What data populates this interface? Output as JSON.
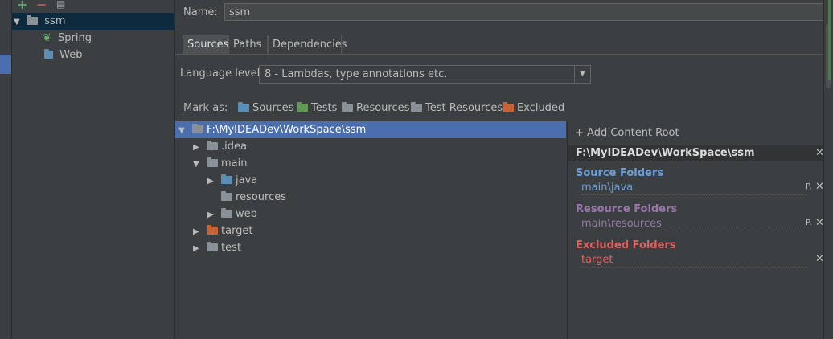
{
  "colors": {
    "background": "#3c3f41",
    "selection": "#4b6eaf",
    "source_folders": "#6a9fd8",
    "resource_folders": "#9876aa",
    "excluded_folders": "#e06060"
  },
  "module_tree": {
    "toolbar": {
      "add_icon": "plus-icon",
      "remove_icon": "minus-icon",
      "copy_icon": "copy-icon"
    },
    "items": [
      {
        "label": "ssm",
        "icon": "module-icon"
      },
      {
        "label": "Spring",
        "icon": "spring-leaf-icon"
      },
      {
        "label": "Web",
        "icon": "web-facet-icon"
      }
    ]
  },
  "name": {
    "label": "Name:",
    "value": "ssm"
  },
  "tabs": [
    "Sources",
    "Paths",
    "Dependencies"
  ],
  "language_level": {
    "label": "Language level:",
    "value": "8 - Lambdas, type annotations etc."
  },
  "mark_as": {
    "label": "Mark as:",
    "items": [
      {
        "label": "Sources",
        "icon": "source-folder-icon"
      },
      {
        "label": "Tests",
        "icon": "test-folder-icon"
      },
      {
        "label": "Resources",
        "icon": "resource-folder-icon"
      },
      {
        "label": "Test Resources",
        "icon": "test-resource-folder-icon"
      },
      {
        "label": "Excluded",
        "icon": "excluded-folder-icon"
      }
    ]
  },
  "dir_tree": [
    {
      "label": "F:\\MyIDEADev\\WorkSpace\\ssm"
    },
    {
      "label": ".idea"
    },
    {
      "label": "main"
    },
    {
      "label": "java"
    },
    {
      "label": "resources"
    },
    {
      "label": "web"
    },
    {
      "label": "target"
    },
    {
      "label": "test"
    }
  ],
  "content_root": {
    "add_label": "+ Add Content Root",
    "path": "F:\\MyIDEADev\\WorkSpace\\ssm",
    "source_title": "Source Folders",
    "source_entries": [
      "main\\java"
    ],
    "resource_title": "Resource Folders",
    "resource_entries": [
      "main\\resources"
    ],
    "excluded_title": "Excluded Folders",
    "excluded_entries": [
      "target"
    ]
  }
}
